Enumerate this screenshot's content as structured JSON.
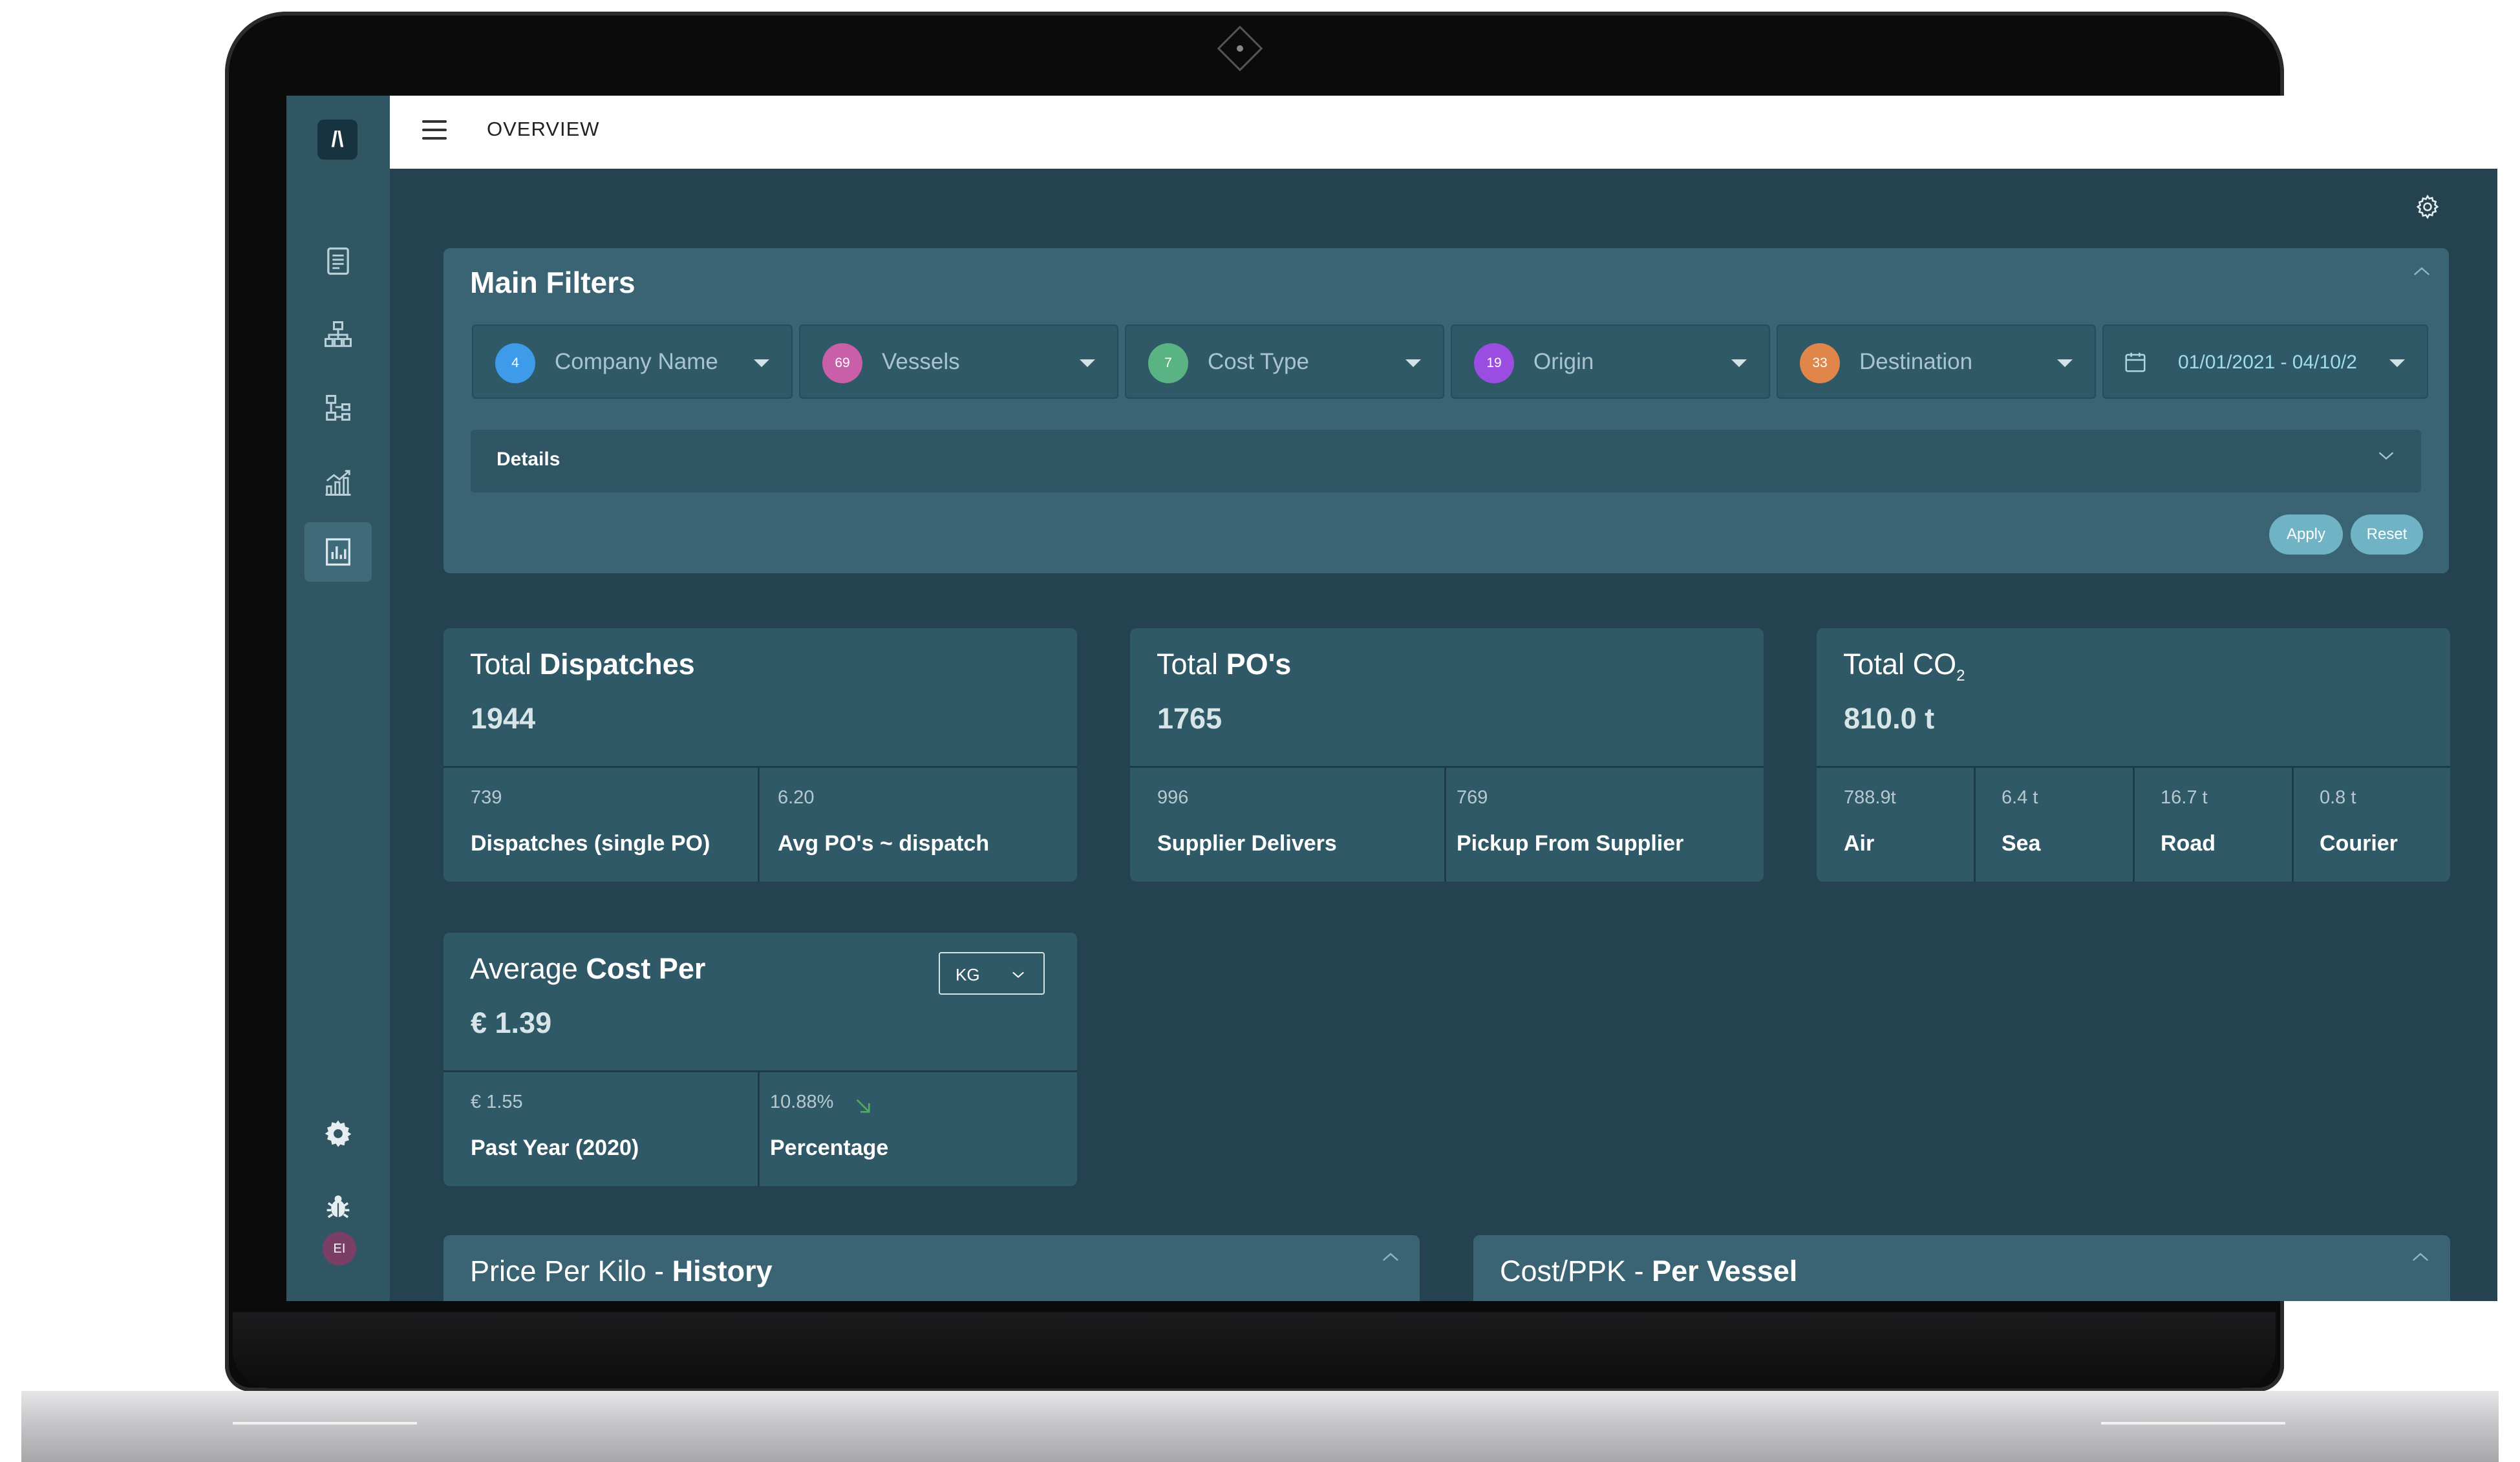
{
  "app": {
    "page_title": "OVERVIEW",
    "logo_text": "/\\",
    "user_initials": "EI"
  },
  "sidebar": {
    "items": [
      {
        "icon": "document-icon"
      },
      {
        "icon": "org-chart-icon"
      },
      {
        "icon": "workflow-icon"
      },
      {
        "icon": "trend-chart-icon"
      },
      {
        "icon": "bar-chart-icon",
        "active": true
      }
    ],
    "bottom": [
      {
        "icon": "gear-icon"
      },
      {
        "icon": "bug-icon"
      }
    ]
  },
  "filters": {
    "title": "Main Filters",
    "items": [
      {
        "badge": "4",
        "label": "Company Name",
        "color": "#3d9be9"
      },
      {
        "badge": "69",
        "label": "Vessels",
        "color": "#c85fa8"
      },
      {
        "badge": "7",
        "label": "Cost Type",
        "color": "#5ab383"
      },
      {
        "badge": "19",
        "label": "Origin",
        "color": "#9a4de0"
      },
      {
        "badge": "33",
        "label": "Destination",
        "color": "#e0864a"
      }
    ],
    "date_range": "01/01/2021 - 04/10/2",
    "details_label": "Details",
    "apply_label": "Apply",
    "reset_label": "Reset"
  },
  "cards": {
    "dispatches": {
      "title_prefix": "Total",
      "title_bold": "Dispatches",
      "value": "1944",
      "cells": [
        {
          "num": "739",
          "label": "Dispatches (single PO)"
        },
        {
          "num": "6.20",
          "label": "Avg PO's ~ dispatch"
        }
      ]
    },
    "pos": {
      "title_prefix": "Total",
      "title_bold": "PO's",
      "value": "1765",
      "cells": [
        {
          "num": "996",
          "label": "Supplier Delivers"
        },
        {
          "num": "769",
          "label": "Pickup From Supplier"
        }
      ]
    },
    "co2": {
      "title_prefix": "Total",
      "title_bold": "CO",
      "title_sub": "2",
      "value": "810.0 t",
      "cells": [
        {
          "num": "788.9t",
          "label": "Air"
        },
        {
          "num": "6.4 t",
          "label": "Sea"
        },
        {
          "num": "16.7 t",
          "label": "Road"
        },
        {
          "num": "0.8 t",
          "label": "Courier"
        }
      ]
    },
    "avg_cost": {
      "title_prefix": "Average",
      "title_bold": "Cost Per",
      "value": "€ 1.39",
      "unit": "KG",
      "cells": [
        {
          "num": "€ 1.55",
          "label": "Past Year (2020)"
        },
        {
          "num": "10.88%",
          "label": "Percentage"
        }
      ],
      "trend_color": "#4caf50"
    },
    "ppk_history": {
      "title_prefix": "Price Per Kilo -",
      "title_bold": "History"
    },
    "cost_ppk": {
      "title_prefix": "Cost/PPK -",
      "title_bold": "Per Vessel"
    }
  },
  "colors": {
    "background": "#24424f",
    "panel": "#3a6474",
    "card": "#305968",
    "accent": "#6fb3c4"
  }
}
